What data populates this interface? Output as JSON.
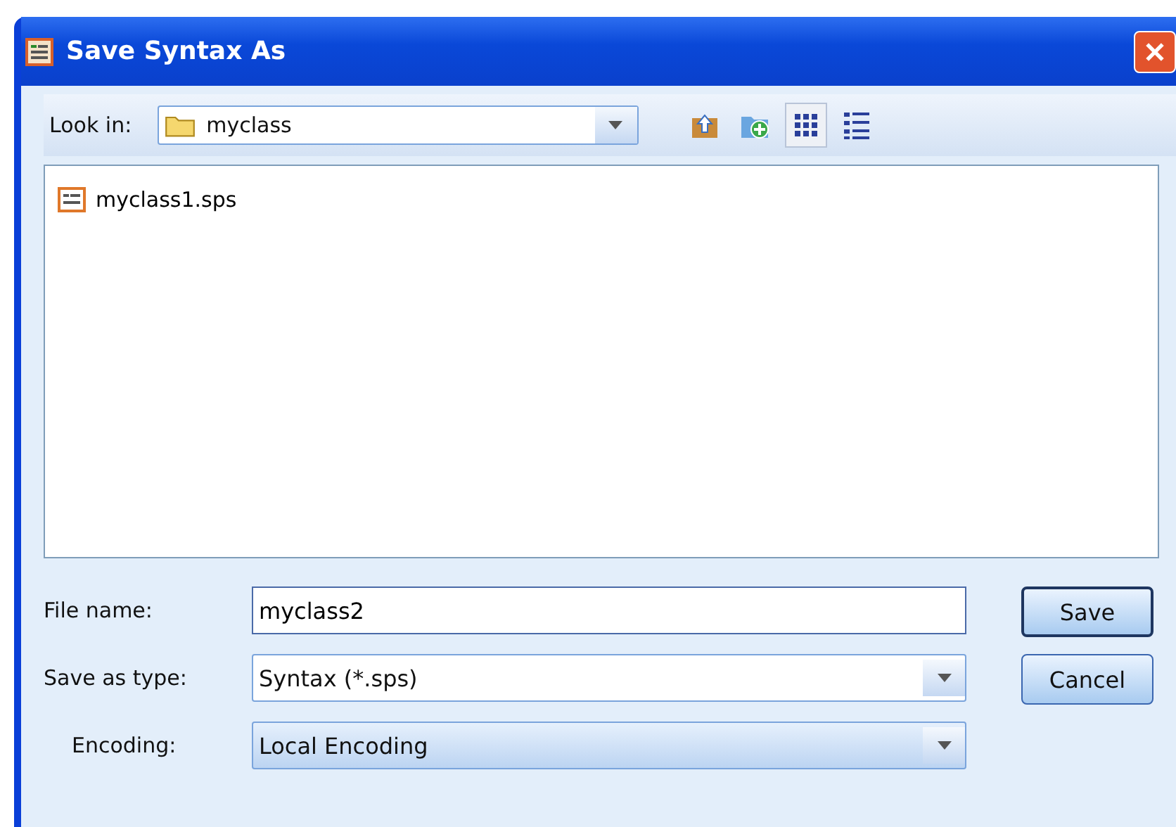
{
  "window": {
    "title": "Save Syntax As"
  },
  "look_in": {
    "label": "Look in:",
    "value": "myclass"
  },
  "toolbar": [
    {
      "kind": "up",
      "selected": false
    },
    {
      "kind": "new-folder",
      "selected": false
    },
    {
      "kind": "list-view",
      "selected": true
    },
    {
      "kind": "details-view",
      "selected": false
    }
  ],
  "files": [
    {
      "name": "myclass1.sps",
      "selected": false
    }
  ],
  "fields": [
    {
      "kind": "text",
      "label": "File name:",
      "value": "myclass2"
    },
    {
      "kind": "dropdown",
      "label": "Save as type:",
      "value": "Syntax (*.sps)"
    },
    {
      "kind": "dropdown",
      "label": "Encoding:",
      "value": "Local Encoding"
    }
  ],
  "buttons": [
    {
      "label": "Save",
      "default": true
    },
    {
      "label": "Cancel",
      "default": false
    }
  ]
}
